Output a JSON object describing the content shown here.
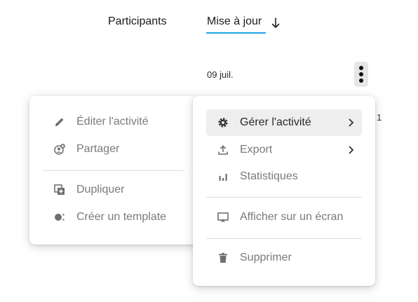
{
  "header": {
    "tab_participants": "Participants",
    "tab_update": "Mise à jour",
    "sort_icon": "arrow-down-icon"
  },
  "row": {
    "date": "09 juil.",
    "edge_char": "1"
  },
  "left_menu": {
    "items": [
      {
        "label": "Éditer l'activité",
        "icon": "pencil-icon"
      },
      {
        "label": "Partager",
        "icon": "share-user-icon"
      },
      {
        "label": "Dupliquer",
        "icon": "duplicate-icon"
      },
      {
        "label": "Créer un template",
        "icon": "template-icon"
      }
    ]
  },
  "right_menu": {
    "items": [
      {
        "label": "Gérer l'activité",
        "icon": "gear-icon",
        "submenu": true,
        "active": true
      },
      {
        "label": "Export",
        "icon": "upload-icon",
        "submenu": true
      },
      {
        "label": "Statistiques",
        "icon": "bar-chart-icon"
      },
      {
        "label": "Afficher sur un écran",
        "icon": "screen-cast-icon"
      },
      {
        "label": "Supprimer",
        "icon": "trash-icon"
      }
    ]
  },
  "colors": {
    "accent_underline": "#1ea7e4",
    "active_item_bg": "#eeeeee",
    "kebab_bg": "#e6e6e6"
  }
}
